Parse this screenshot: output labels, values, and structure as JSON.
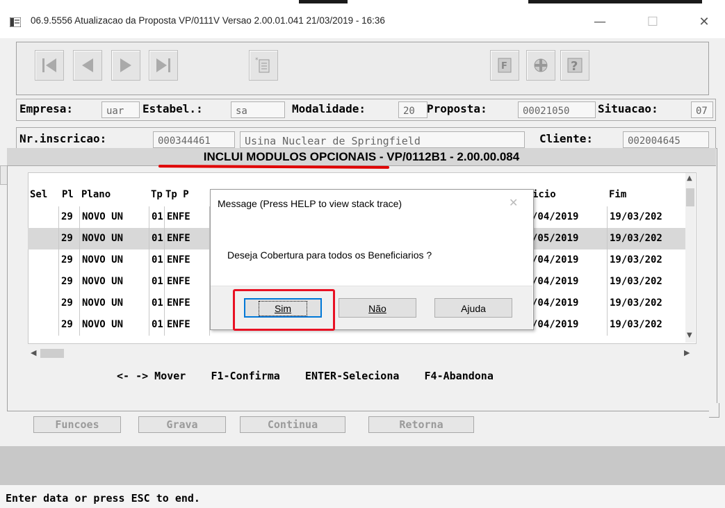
{
  "window": {
    "title": "06.9.5556 Atualizacao da Proposta VP/0111V Versao 2.00.01.041 21/03/2019 - 16:36",
    "minimize": "—",
    "maximize": "☐",
    "close": "✕"
  },
  "toolbar": {
    "buttons": [
      "first-record-icon",
      "previous-record-icon",
      "next-record-icon",
      "last-record-icon",
      "document-icon",
      "print-icon",
      "tools-icon",
      "help-icon"
    ]
  },
  "header": {
    "empresa_label": "Empresa:",
    "empresa_value": "uar",
    "estabel_label": "Estabel.:",
    "estabel_value": "sa",
    "modalidade_label": "Modalidade:",
    "modalidade_value": "20",
    "proposta_label": "Proposta:",
    "proposta_value": "00021050",
    "situacao_label": "Situacao:",
    "situacao_value": "07",
    "inscricao_label": "Nr.inscricao:",
    "inscricao_value": "000344461",
    "cliente_name": "Usina Nuclear de Springfield",
    "cliente_label": "Cliente:",
    "cliente_value": "002004645"
  },
  "panel": {
    "title": "INCLUI MODULOS OPCIONAIS - VP/0112B1 - 2.00.00.084",
    "columns": {
      "sel": "Sel",
      "pl": "Pl",
      "plano": "Plano",
      "tp": "Tp",
      "tp_p": "Tp P",
      "inicio": "icio",
      "fim": "Fim"
    },
    "rows": [
      {
        "pl": "29",
        "plano": "NOVO UN",
        "tp": "01",
        "tp_p": "ENFE",
        "inicio": "/04/2019",
        "fim": "19/03/202"
      },
      {
        "pl": "29",
        "plano": "NOVO UN",
        "tp": "01",
        "tp_p": "ENFE",
        "inicio": "/05/2019",
        "fim": "19/03/202"
      },
      {
        "pl": "29",
        "plano": "NOVO UN",
        "tp": "01",
        "tp_p": "ENFE",
        "inicio": "/04/2019",
        "fim": "19/03/202"
      },
      {
        "pl": "29",
        "plano": "NOVO UN",
        "tp": "01",
        "tp_p": "ENFE",
        "inicio": "/04/2019",
        "fim": "19/03/202"
      },
      {
        "pl": "29",
        "plano": "NOVO UN",
        "tp": "01",
        "tp_p": "ENFE",
        "inicio": "/04/2019",
        "fim": "19/03/202"
      },
      {
        "pl": "29",
        "plano": "NOVO UN",
        "tp": "01",
        "tp_p": "ENFE",
        "inicio": "/04/2019",
        "fim": "19/03/202"
      }
    ],
    "keys_help": "<- -> Mover    F1-Confirma    ENTER-Seleciona    F4-Abandona"
  },
  "function_buttons": {
    "funcoes": "Funcoes",
    "grava": "Grava",
    "continua": "Continua",
    "retorna": "Retorna"
  },
  "dialog": {
    "title": "Message (Press HELP to view stack trace)",
    "message": "Deseja Cobertura para todos os Beneficiarios ?",
    "yes": "Sim",
    "no": "Não",
    "help": "Ajuda"
  },
  "status": {
    "text": "Enter data or press ESC to end."
  },
  "colors": {
    "highlight": "#e81123",
    "underline": "#e00000",
    "focus": "#0078d7"
  }
}
